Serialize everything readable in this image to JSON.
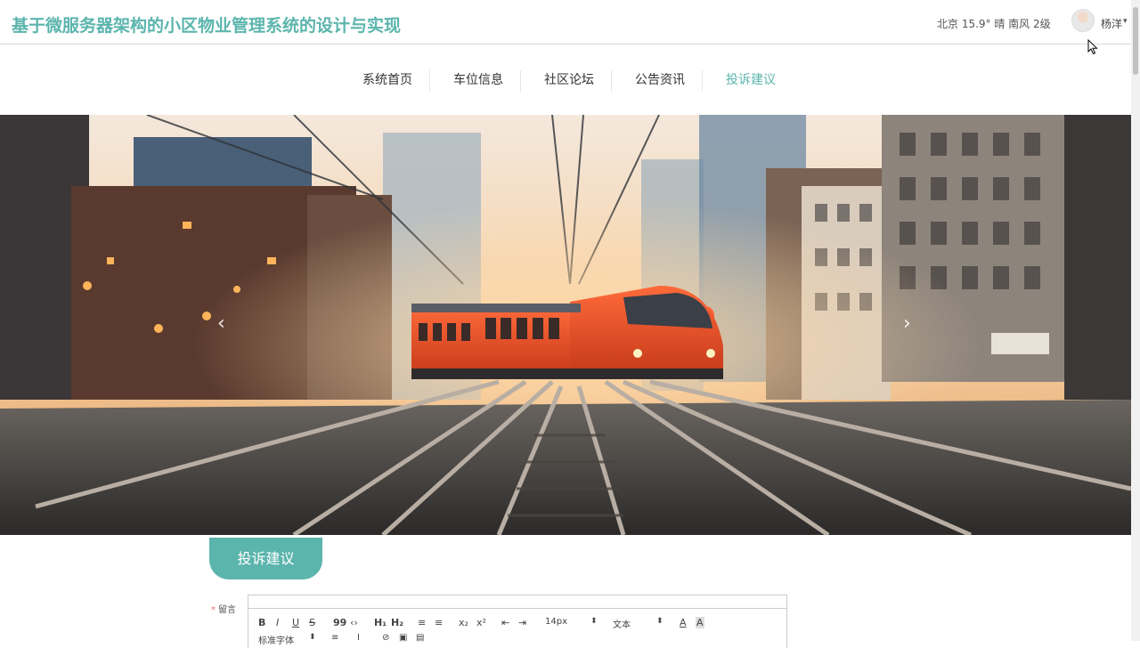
{
  "header": {
    "title": "基于微服务器架构的小区物业管理系统的设计与实现",
    "weather": "北京  15.9°  晴  南风  2级",
    "username": "杨洋",
    "caret": "▾"
  },
  "nav": {
    "items": [
      {
        "label": "系统首页"
      },
      {
        "label": "车位信息"
      },
      {
        "label": "社区论坛"
      },
      {
        "label": "公告资讯"
      },
      {
        "label": "投诉建议"
      }
    ],
    "active_index": 4
  },
  "banner": {
    "prev_arrow": "‹",
    "next_arrow": "›"
  },
  "section": {
    "title": "投诉建议"
  },
  "form": {
    "required_mark": "*",
    "message_label": "留言",
    "toolbar": {
      "bold": "B",
      "italic": "I",
      "underline": "U",
      "strike": "S",
      "quote": "99",
      "code": "‹›",
      "h1": "H₁",
      "h2": "H₂",
      "ordered": "≡",
      "bullet": "≡",
      "sub": "x₂",
      "sup": "x²",
      "outdent": "⇤",
      "indent": "⇥",
      "size": "14px",
      "size_caret": "⬍",
      "type": "文本",
      "type_caret": "⬍",
      "color": "A",
      "bg": "A",
      "font": "标准字体",
      "font_caret": "⬍",
      "align": "≡",
      "clean": "Ⅰ",
      "link": "⊘",
      "image": "▣",
      "video": "▤"
    }
  },
  "colors": {
    "accent": "#5bb5ad",
    "required": "#f56c6c"
  }
}
